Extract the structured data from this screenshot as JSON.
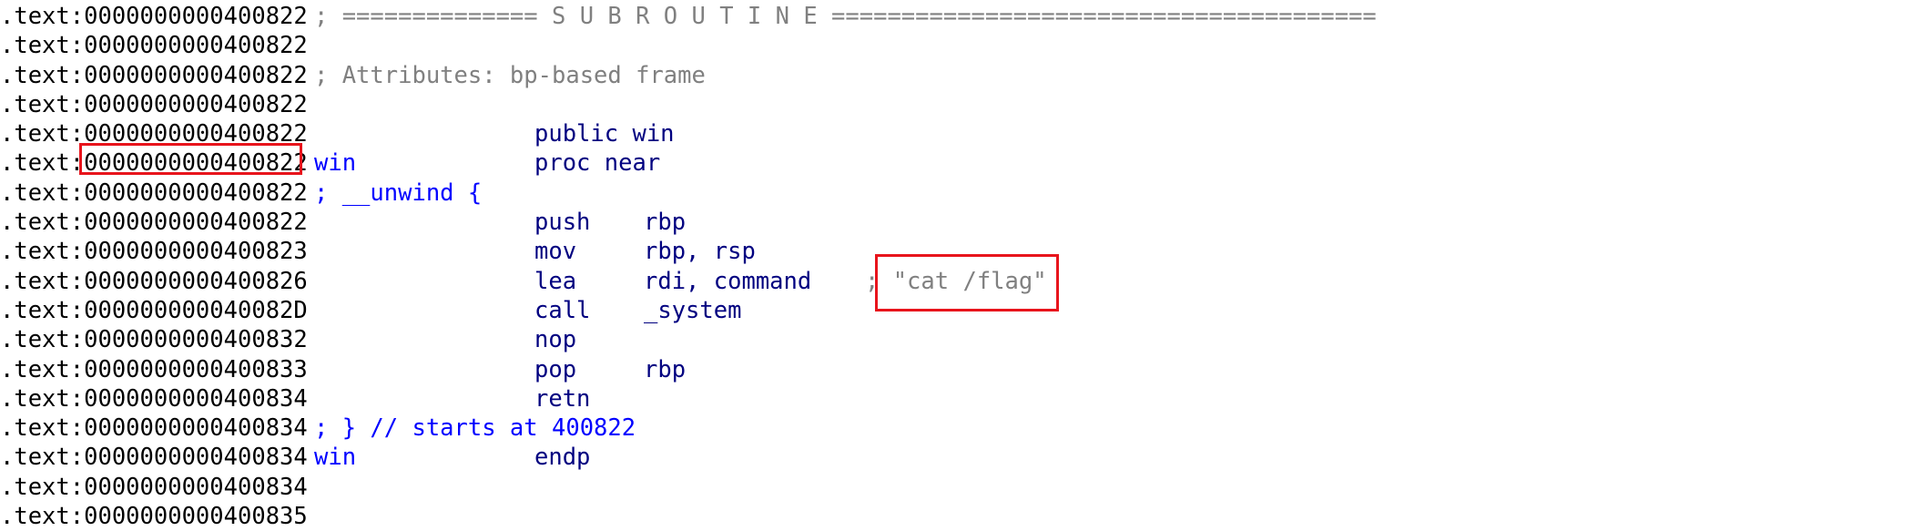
{
  "segment_prefix": ".text:",
  "lines": [
    {
      "addr": "0000000000400822",
      "comment": "; ============== S U B R O U T I N E ======================================="
    },
    {
      "addr": "0000000000400822"
    },
    {
      "addr": "0000000000400822",
      "comment": "; Attributes: bp-based frame"
    },
    {
      "addr": "0000000000400822"
    },
    {
      "addr": "0000000000400822",
      "mnem": "public win"
    },
    {
      "addr": "0000000000400822",
      "label": "win",
      "mnem": "proc near"
    },
    {
      "addr": "0000000000400822",
      "label_blue": "; __unwind {"
    },
    {
      "addr": "0000000000400822",
      "mnem": "push",
      "op": "rbp"
    },
    {
      "addr": "0000000000400823",
      "mnem": "mov",
      "op": "rbp, rsp"
    },
    {
      "addr": "0000000000400826",
      "mnem": "lea",
      "op": "rdi, command",
      "cmt": "; \"cat /flag\""
    },
    {
      "addr": "000000000040082D",
      "mnem": "call",
      "op": "_system"
    },
    {
      "addr": "0000000000400832",
      "mnem": "nop"
    },
    {
      "addr": "0000000000400833",
      "mnem": "pop",
      "op": "rbp"
    },
    {
      "addr": "0000000000400834",
      "mnem": "retn"
    },
    {
      "addr": "0000000000400834",
      "label_blue": "; } // starts at 400822"
    },
    {
      "addr": "0000000000400834",
      "label": "win",
      "mnem": "endp"
    },
    {
      "addr": "0000000000400834"
    },
    {
      "addr": "0000000000400835"
    }
  ],
  "colors": {
    "address": "#000000",
    "keyword": "#0000ff",
    "operand": "#000080",
    "comment": "#808080",
    "highlight_box": "#e8141c"
  }
}
